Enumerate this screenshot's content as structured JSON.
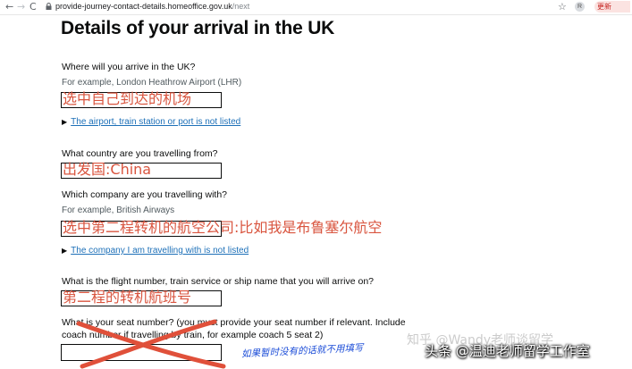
{
  "browser": {
    "back": "←",
    "forward": "→",
    "reload": "C",
    "url_host": "provide-journey-contact-details.homeoffice.gov.uk",
    "url_path": "/next",
    "update_label": "更新"
  },
  "page": {
    "title": "Details of your arrival in the UK"
  },
  "arrival": {
    "question": "Where will you arrive in the UK?",
    "hint": "For example, London Heathrow Airport (LHR)",
    "annotation": "选中自己到达的机场",
    "details_link": "The airport, train station or port is not listed"
  },
  "country": {
    "question": "What country are you travelling from?",
    "annotation": "出发国:China"
  },
  "company": {
    "question": "Which company are you travelling with?",
    "hint": "For example, British Airways",
    "annotation": "选中第二程转机的航空公司:比如我是布鲁塞尔航空",
    "details_link": "The company I am travelling with is not listed"
  },
  "flight": {
    "question": "What is the flight number, train service or ship name that you will arrive on?",
    "annotation": "第二程的转机航班号"
  },
  "seat": {
    "question_line1": "What is your seat number? (you must provide your seat number if relevant. Include",
    "question_line2": "coach number if travelling by train, for example coach 5 seat 2)",
    "handwritten_note": "如果暂时没有的话就不用填写"
  },
  "watermarks": {
    "zhihu": "知乎 @Wandy老师谈留学",
    "toutiao": "头条 @温迪老师留学工作室"
  },
  "colors": {
    "annotation": "#d9553f",
    "link": "#1d70b8",
    "cross": "#e0503a",
    "handwriting": "#1d4ed8"
  }
}
